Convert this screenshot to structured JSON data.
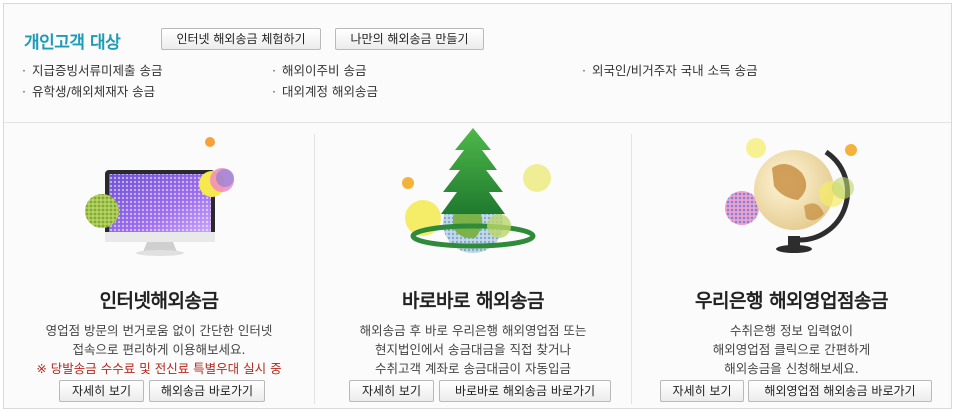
{
  "header": {
    "title": "개인고객 대상",
    "btn_experience": "인터넷 해외송금 체험하기",
    "btn_create": "나만의 해외송금 만들기"
  },
  "items": [
    "지급증빙서류미제출 송금",
    "유학생/해외체재자 송금",
    "해외이주비 송금",
    "대외계정 해외송금",
    "외국인/비거주자 국내 소득 송금"
  ],
  "panels": [
    {
      "title": "인터넷해외송금",
      "lines": [
        "영업점 방문의 번거로움 없이 간단한 인터넷",
        "접속으로 편리하게 이용해보세요."
      ],
      "note": "※ 당발송금 수수료 및 전신료 특별우대 실시 중",
      "btn_detail": "자세히 보기",
      "btn_go": "해외송금 바로가기"
    },
    {
      "title": "바로바로 해외송금",
      "lines": [
        "해외송금 후 바로 우리은행 해외영업점 또는",
        "현지법인에서 송금대금을 직접 찾거나",
        "수취고객 계좌로 송금대금이 자동입금"
      ],
      "btn_detail": "자세히 보기",
      "btn_go": "바로바로 해외송금 바로가기"
    },
    {
      "title": "우리은행 해외영업점송금",
      "lines": [
        "수취은행 정보 입력없이",
        "해외영업점 클릭으로 간편하게",
        "해외송금을 신청해보세요."
      ],
      "btn_detail": "자세히 보기",
      "btn_go": "해외영업점 해외송금 바로가기"
    }
  ]
}
